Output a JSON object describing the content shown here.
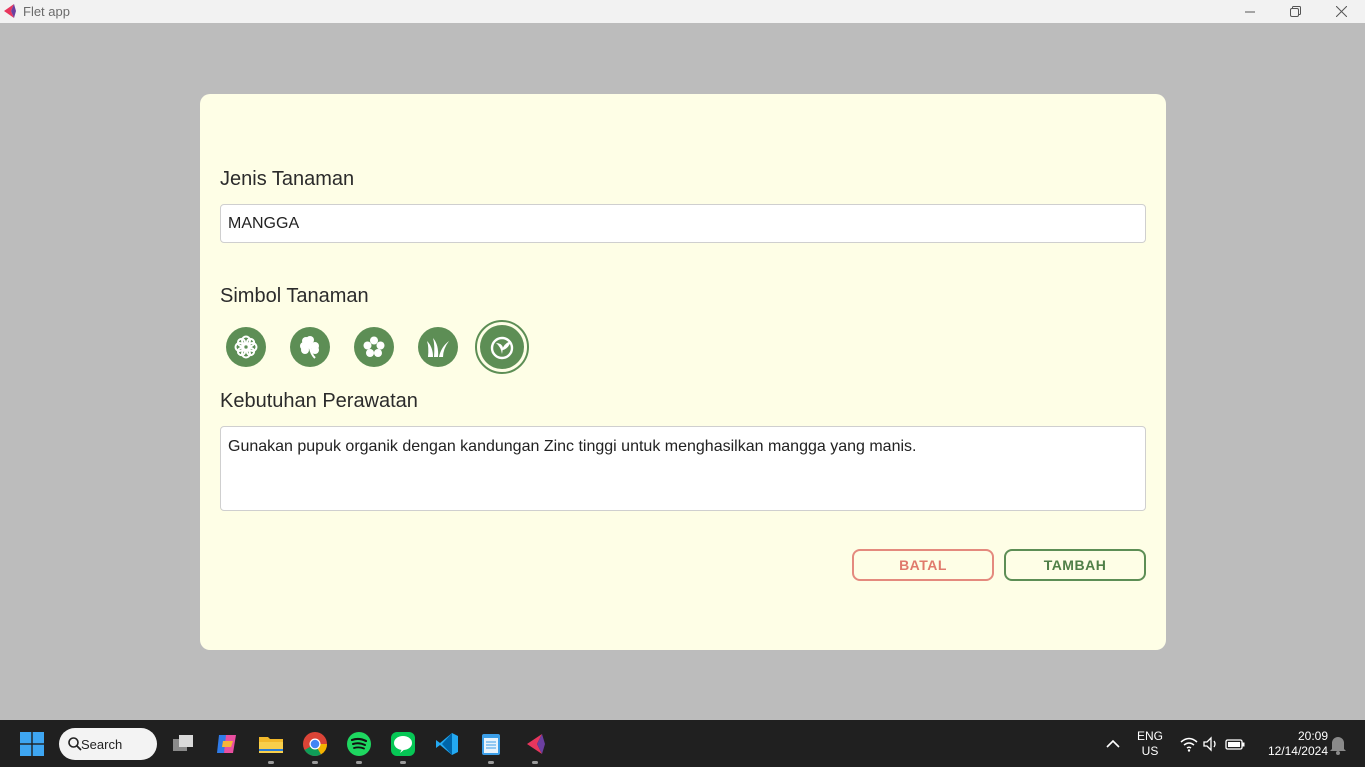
{
  "window": {
    "title": "Flet app"
  },
  "form": {
    "jenis_label": "Jenis Tanaman",
    "jenis_value": "MANGGA",
    "simbol_label": "Simbol Tanaman",
    "symbols": [
      {
        "icon": "flower-icon",
        "selected": false
      },
      {
        "icon": "clover-icon",
        "selected": false
      },
      {
        "icon": "flower-petals-icon",
        "selected": false
      },
      {
        "icon": "grass-icon",
        "selected": false
      },
      {
        "icon": "sprout-icon",
        "selected": true
      }
    ],
    "kebutuhan_label": "Kebutuhan Perawatan",
    "kebutuhan_value": "Gunakan pupuk organik dengan kandungan Zinc tinggi untuk menghasilkan mangga yang manis.",
    "batal_label": "BATAL",
    "tambah_label": "TAMBAH"
  },
  "colors": {
    "accent": "#5d8e55",
    "danger": "#e07a6c",
    "card": "#fefee6"
  },
  "taskbar": {
    "search_label": "Search",
    "apps": [
      "task-view-icon",
      "copilot-icon",
      "file-explorer-icon",
      "chrome-icon",
      "spotify-icon",
      "line-icon",
      "vscode-icon",
      "notepad-icon",
      "flet-icon"
    ],
    "lang_top": "ENG",
    "lang_bottom": "US",
    "time": "20:09",
    "date": "12/14/2024"
  }
}
